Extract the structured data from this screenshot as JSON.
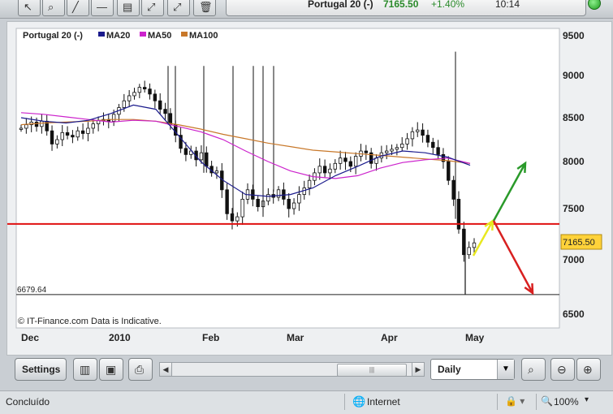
{
  "header": {
    "instrument": "Portugal 20 (-)",
    "price": "7165.50",
    "change": "+1.40%",
    "time": "10:14"
  },
  "toolbar_icons": [
    "pointer-icon",
    "zoom-select-icon",
    "draw-line-icon",
    "horizontal-line-icon",
    "indicator-icon",
    "fibonacci-icon",
    "trend-tool-icon",
    "delete-icon"
  ],
  "chart": {
    "legend": {
      "instrument": "Portugal 20 (-)",
      "ma20": "MA20",
      "ma50": "MA50",
      "ma100": "MA100"
    },
    "colors": {
      "ma20": "#1a1a8c",
      "ma50": "#cc22cc",
      "ma100": "#c8782a",
      "price": "#111111",
      "support": "#e01010",
      "arrow_up": "#2a9a2a",
      "arrow_mid": "#e8e820",
      "arrow_down": "#d82020",
      "price_tag_bg": "#ffd23a"
    },
    "y_axis_ticks": [
      "9500",
      "9000",
      "8500",
      "8000",
      "7500",
      "7000",
      "6500"
    ],
    "x_axis_ticks": [
      "Dec",
      "2010",
      "Feb",
      "Mar",
      "Apr",
      "May"
    ],
    "current_price_tag": "7165.50",
    "low_label": "6679.64",
    "disclaimer": "© IT-Finance.com Data is Indicative."
  },
  "chart_data": {
    "type": "candlestick",
    "x_labels": [
      "Dec",
      "2010",
      "Feb",
      "Mar",
      "Apr",
      "May"
    ],
    "y_ticks": [
      9500,
      9000,
      8500,
      8000,
      7500,
      7000,
      6500
    ],
    "ylim": [
      6500,
      9500
    ],
    "support_level": 7350,
    "low_marker": 6679.64,
    "last_price": 7165.5,
    "series": [
      {
        "name": "MA20",
        "values": [
          8500,
          8460,
          8440,
          8470,
          8550,
          8650,
          8600,
          8300,
          8000,
          7800,
          7650,
          7630,
          7650,
          7720,
          7850,
          7950,
          8060,
          8120,
          8100,
          8050,
          7960
        ]
      },
      {
        "name": "MA50",
        "values": [
          8560,
          8540,
          8510,
          8480,
          8450,
          8470,
          8460,
          8400,
          8340,
          8250,
          8120,
          8000,
          7900,
          7840,
          7820,
          7850,
          7930,
          7990,
          8020,
          8040,
          7980
        ]
      },
      {
        "name": "MA100",
        "values": [
          8420,
          8440,
          8450,
          8460,
          8480,
          8480,
          8460,
          8420,
          8370,
          8310,
          8260,
          8210,
          8170,
          8130,
          8110,
          8090,
          8070,
          8050,
          8030,
          8010,
          7980
        ]
      }
    ]
  },
  "controls": {
    "settings": "Settings",
    "timeframe": "Daily"
  },
  "status": {
    "left": "Concluído",
    "zone": "Internet",
    "zoom": "100%"
  }
}
